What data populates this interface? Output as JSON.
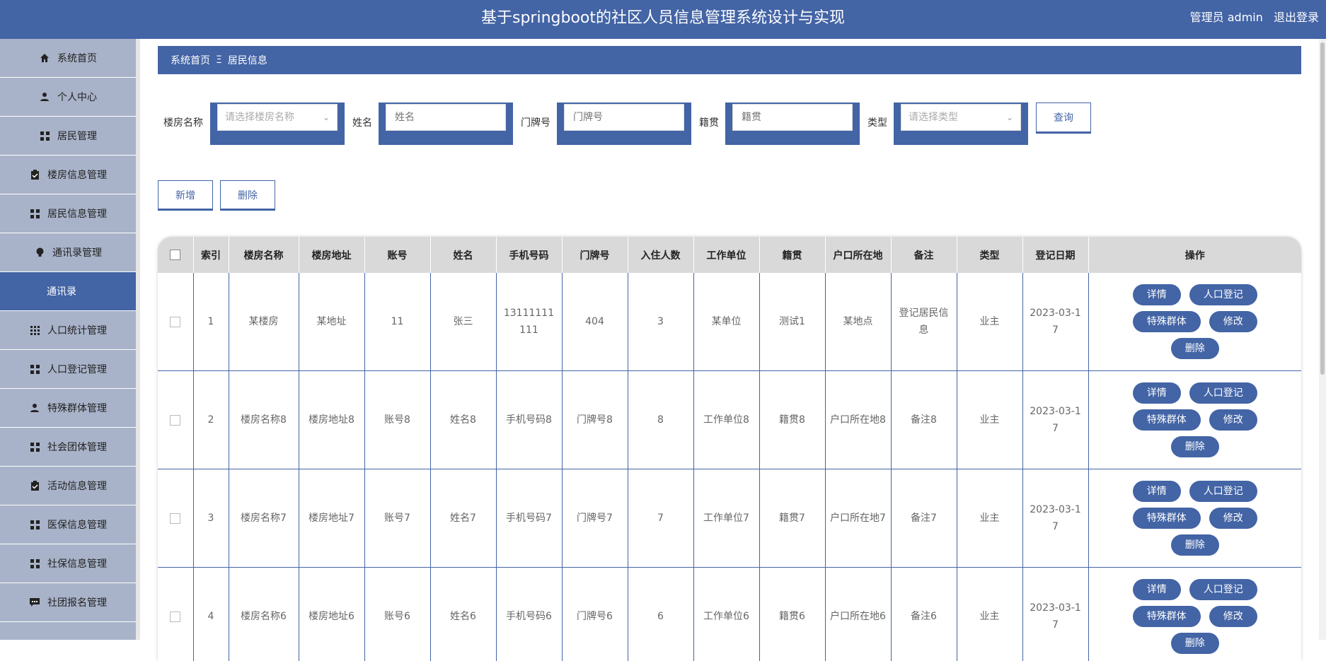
{
  "header": {
    "title": "基于springboot的社区人员信息管理系统设计与实现",
    "user_label": "管理员 admin",
    "logout_label": "退出登录"
  },
  "sidebar": {
    "items": [
      {
        "label": "系统首页",
        "icon": "home-icon"
      },
      {
        "label": "个人中心",
        "icon": "user-icon"
      },
      {
        "label": "居民管理",
        "icon": "grid-icon"
      },
      {
        "label": "楼房信息管理",
        "icon": "clipboard-icon"
      },
      {
        "label": "居民信息管理",
        "icon": "grid-icon"
      },
      {
        "label": "通讯录管理",
        "icon": "bulb-icon"
      },
      {
        "label": "通讯录",
        "icon": "",
        "active": true
      },
      {
        "label": "人口统计管理",
        "icon": "grid9-icon"
      },
      {
        "label": "人口登记管理",
        "icon": "grid-icon"
      },
      {
        "label": "特殊群体管理",
        "icon": "user-icon"
      },
      {
        "label": "社会团体管理",
        "icon": "grid-icon"
      },
      {
        "label": "活动信息管理",
        "icon": "clipboard-icon"
      },
      {
        "label": "医保信息管理",
        "icon": "grid-icon"
      },
      {
        "label": "社保信息管理",
        "icon": "grid-icon"
      },
      {
        "label": "社团报名管理",
        "icon": "chat-icon"
      }
    ]
  },
  "breadcrumb": {
    "home": "系统首页",
    "separator": "Ξ",
    "current": "居民信息"
  },
  "search": {
    "building_label": "楼房名称",
    "building_placeholder": "请选择楼房名称",
    "name_label": "姓名",
    "name_placeholder": "姓名",
    "door_label": "门牌号",
    "door_placeholder": "门牌号",
    "origin_label": "籍贯",
    "origin_placeholder": "籍贯",
    "type_label": "类型",
    "type_placeholder": "请选择类型",
    "query_label": "查询"
  },
  "actions": {
    "add_label": "新增",
    "delete_label": "删除"
  },
  "table": {
    "headers": [
      "索引",
      "楼房名称",
      "楼房地址",
      "账号",
      "姓名",
      "手机号码",
      "门牌号",
      "入住人数",
      "工作单位",
      "籍贯",
      "户口所在地",
      "备注",
      "类型",
      "登记日期",
      "操作"
    ],
    "rows": [
      {
        "index": "1",
        "building": "某楼房",
        "address": "某地址",
        "account": "11",
        "name": "张三",
        "phone": "13111111111",
        "door": "404",
        "count": "3",
        "work": "某单位",
        "origin": "测试1",
        "hukou": "某地点",
        "note": "登记居民信息",
        "type": "业主",
        "date": "2023-03-17"
      },
      {
        "index": "2",
        "building": "楼房名称8",
        "address": "楼房地址8",
        "account": "账号8",
        "name": "姓名8",
        "phone": "手机号码8",
        "door": "门牌号8",
        "count": "8",
        "work": "工作单位8",
        "origin": "籍贯8",
        "hukou": "户口所在地8",
        "note": "备注8",
        "type": "业主",
        "date": "2023-03-17"
      },
      {
        "index": "3",
        "building": "楼房名称7",
        "address": "楼房地址7",
        "account": "账号7",
        "name": "姓名7",
        "phone": "手机号码7",
        "door": "门牌号7",
        "count": "7",
        "work": "工作单位7",
        "origin": "籍贯7",
        "hukou": "户口所在地7",
        "note": "备注7",
        "type": "业主",
        "date": "2023-03-17"
      },
      {
        "index": "4",
        "building": "楼房名称6",
        "address": "楼房地址6",
        "account": "账号6",
        "name": "姓名6",
        "phone": "手机号码6",
        "door": "门牌号6",
        "count": "6",
        "work": "工作单位6",
        "origin": "籍贯6",
        "hukou": "户口所在地6",
        "note": "备注6",
        "type": "业主",
        "date": "2023-03-17"
      }
    ],
    "ops": {
      "detail": "详情",
      "register": "人口登记",
      "special": "特殊群体",
      "edit": "修改",
      "delete": "删除"
    }
  },
  "colors": {
    "primary": "#4364a5",
    "sidebar": "#a8b3c9",
    "header_row": "#d9d9d9"
  }
}
